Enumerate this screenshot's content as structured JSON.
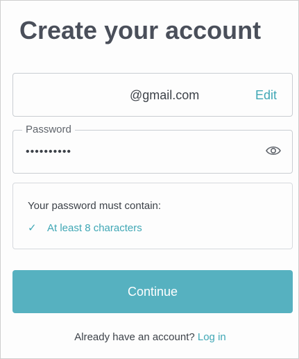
{
  "title": "Create your account",
  "email": {
    "value": "@gmail.com",
    "edit_label": "Edit"
  },
  "password": {
    "label": "Password",
    "value": "••••••••••",
    "toggle_icon": "eye-icon"
  },
  "requirements": {
    "title": "Your password must contain:",
    "items": [
      {
        "check": "✓",
        "label": "At least 8 characters"
      }
    ]
  },
  "continue_label": "Continue",
  "footer": {
    "prompt": "Already have an account?",
    "login_label": "Log in"
  },
  "colors": {
    "accent": "#3fa7b5",
    "button": "#56b1c0",
    "title": "#4a4f5a"
  }
}
